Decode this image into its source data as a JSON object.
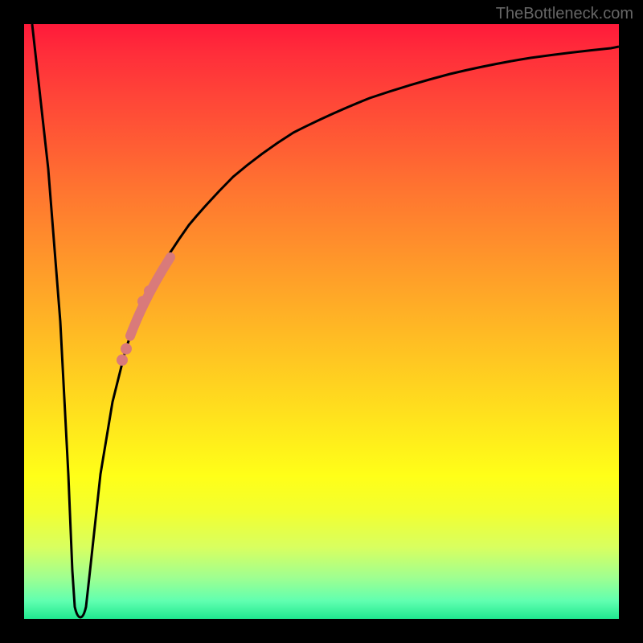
{
  "watermark": "TheBottleneck.com",
  "chart_data": {
    "type": "line",
    "title": "",
    "xlabel": "",
    "ylabel": "",
    "xlim": [
      0,
      100
    ],
    "ylim": [
      0,
      100
    ],
    "series": [
      {
        "name": "bottleneck-curve",
        "x": [
          0,
          2,
          4,
          6,
          7,
          8,
          9,
          10,
          12,
          14,
          16,
          18,
          20,
          22,
          25,
          28,
          32,
          36,
          40,
          45,
          50,
          55,
          60,
          65,
          70,
          75,
          80,
          85,
          90,
          95,
          100
        ],
        "values": [
          100,
          70,
          40,
          15,
          3,
          0,
          3,
          15,
          32,
          42,
          50,
          56,
          61,
          65,
          70,
          74,
          78,
          81,
          84,
          87,
          89,
          90.5,
          92,
          93,
          94,
          94.8,
          95.5,
          96,
          96.5,
          97,
          97.4
        ]
      }
    ],
    "highlight_segment": {
      "name": "dotted-highlight",
      "x_range": [
        16,
        22
      ],
      "description": "salmon dotted overlay on rising portion"
    },
    "minimum_point": {
      "x": 8,
      "y": 0
    },
    "background": "red-to-green vertical gradient"
  }
}
